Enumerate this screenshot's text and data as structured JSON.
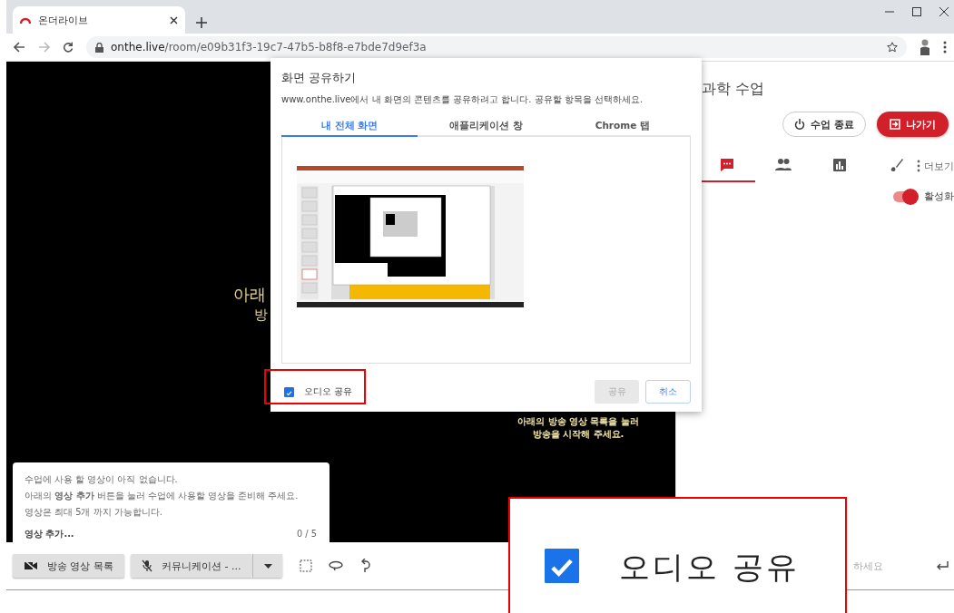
{
  "browser": {
    "tab": {
      "title": "온더라이브"
    },
    "url": {
      "host": "onthe.live",
      "path": "/room/e09b31f3-19c7-47b5-b8f8-e7bde7d9ef3a"
    }
  },
  "stage": {
    "headline": "아래",
    "subline": "방",
    "hint_lines": [
      "아래의 방송 영상 목록을 눌러",
      "방송을 시작해 주세요."
    ]
  },
  "side_panel": {
    "title": "과학 수업",
    "end_button": "수업 종료",
    "exit_button": "나가기",
    "tabs": [
      {
        "kind": "chat",
        "selected": true
      },
      {
        "kind": "people",
        "selected": false
      },
      {
        "kind": "poll",
        "selected": false
      },
      {
        "kind": "draw",
        "selected": false
      }
    ],
    "more": "더보기",
    "toggle": {
      "label": "활성화",
      "on": true
    }
  },
  "video_card": {
    "lines": [
      "수업에 사용 할 영상이 아직 없습니다.",
      "아래의 **영상 추가** 버튼을 눌러 수업에 사용할 영상을 준비해 주세요.",
      "영상은 최대 5개 까지 가능합니다."
    ],
    "add_label": "영상 추가...",
    "count": "0 / 5"
  },
  "toolbar": {
    "list_button": "방송 영상 목록",
    "mic_button": "커뮤니케이션 - ...",
    "chat_placeholder": "하세요"
  },
  "share_dialog": {
    "title": "화면 공유하기",
    "description": "www.onthe.live에서 내 화면의 콘텐츠를 공유하려고 합니다. 공유할 항목을 선택하세요.",
    "tabs": [
      {
        "label": "내 전체 화면",
        "selected": true
      },
      {
        "label": "애플리케이션 창",
        "selected": false
      },
      {
        "label": "Chrome 탭",
        "selected": false
      }
    ],
    "audio": {
      "label": "오디오 공유",
      "checked": true
    },
    "share_button": {
      "label": "공유",
      "disabled": true
    },
    "cancel_button": "취소"
  },
  "zoom_callout": {
    "label": "오디오 공유",
    "checked": true
  }
}
